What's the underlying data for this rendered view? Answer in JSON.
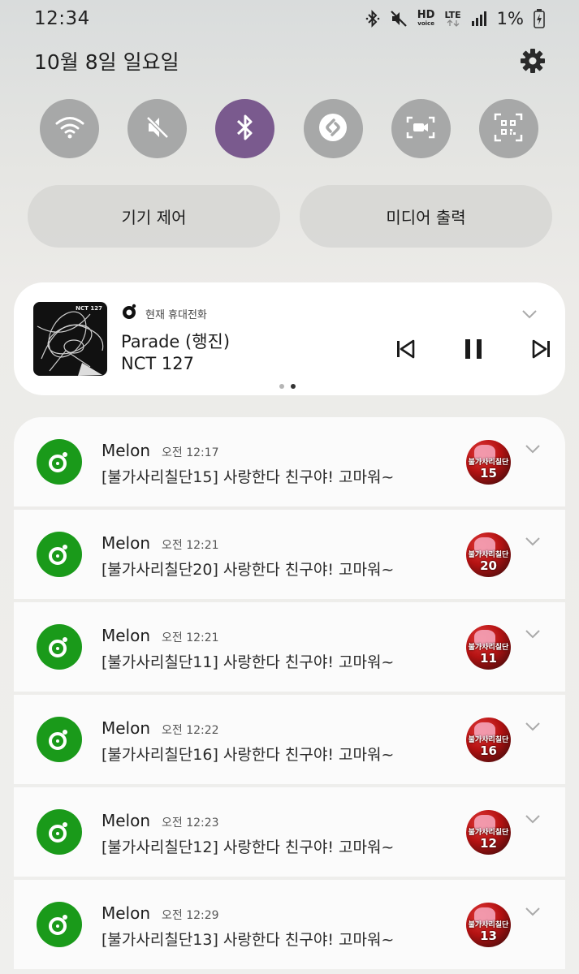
{
  "status_bar": {
    "time": "12:34",
    "hd_label": "HD",
    "voice_label": "voice",
    "lte_label": "LTE",
    "battery_percent": "1%",
    "icons": [
      "bluetooth-icon",
      "mute-icon",
      "hd-voice-icon",
      "lte-icon",
      "signal-icon",
      "battery-charging-icon"
    ]
  },
  "header": {
    "date": "10월 8일 일요일",
    "settings_icon": "gear-icon"
  },
  "quick_toggles": [
    {
      "name": "wifi",
      "icon": "wifi-icon",
      "active": false
    },
    {
      "name": "sound",
      "icon": "mute-icon",
      "active": false
    },
    {
      "name": "bluetooth",
      "icon": "bluetooth-icon",
      "active": true
    },
    {
      "name": "shazam",
      "icon": "shazam-icon",
      "active": false
    },
    {
      "name": "screen-recorder",
      "icon": "screen-record-icon",
      "active": false
    },
    {
      "name": "qr-scanner",
      "icon": "qr-scan-icon",
      "active": false
    }
  ],
  "colors": {
    "active_toggle": "#7a5a8e",
    "inactive_toggle": "#a7a8a8",
    "melon_green": "#1a9a1a"
  },
  "pills": {
    "device_control": "기기 제어",
    "media_output": "미디어 출력"
  },
  "media": {
    "source": "현재 휴대전화",
    "album_tag": "NCT 127",
    "title": "Parade (행진)",
    "artist": "NCT 127",
    "controls": [
      "previous-icon",
      "pause-icon",
      "next-icon"
    ],
    "page_count": 2,
    "active_page": 2
  },
  "notifications": [
    {
      "app": "Melon",
      "time": "오전 12:17",
      "body": "[불가사리칠단15] 사랑한다 친구야! 고마워~",
      "avatar_text": "불가사리칠단",
      "avatar_num": "15"
    },
    {
      "app": "Melon",
      "time": "오전 12:21",
      "body": "[불가사리칠단20] 사랑한다 친구야! 고마워~",
      "avatar_text": "불가사리칠단",
      "avatar_num": "20"
    },
    {
      "app": "Melon",
      "time": "오전 12:21",
      "body": "[불가사리칠단11] 사랑한다 친구야! 고마워~",
      "avatar_text": "불가사리칠단",
      "avatar_num": "11"
    },
    {
      "app": "Melon",
      "time": "오전 12:22",
      "body": "[불가사리칠단16] 사랑한다 친구야! 고마워~",
      "avatar_text": "불가사리칠단",
      "avatar_num": "16"
    },
    {
      "app": "Melon",
      "time": "오전 12:23",
      "body": "[불가사리칠단12] 사랑한다 친구야! 고마워~",
      "avatar_text": "불가사리칠단",
      "avatar_num": "12"
    },
    {
      "app": "Melon",
      "time": "오전 12:29",
      "body": "[불가사리칠단13] 사랑한다 친구야! 고마워~",
      "avatar_text": "불가사리칠단",
      "avatar_num": "13"
    }
  ]
}
